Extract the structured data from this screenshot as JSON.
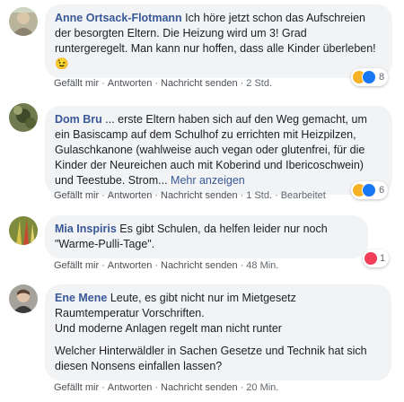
{
  "colors": {
    "link": "#385898",
    "bubble": "#f2f3f5",
    "meta": "#606770"
  },
  "actions": {
    "like": "Gefällt mir",
    "reply": "Antworten",
    "message": "Nachricht senden"
  },
  "comments": [
    {
      "author": "Anne Ortsack-Flotmann",
      "text": "Ich höre jetzt schon das Aufschreien der besorgten Eltern. Die Heizung wird um 3! Grad runtergeregelt. Man kann nur hoffen, dass alle Kinder überleben!",
      "emoji": "😉",
      "time": "2 Std.",
      "reactions": {
        "icons": [
          "haha-icon",
          "like-icon"
        ],
        "count": "8"
      }
    },
    {
      "author": "Dom Bru",
      "text": "... erste Eltern haben sich auf den Weg gemacht, um ein Basiscamp auf dem Schulhof zu errichten mit Heizpilzen, Gulaschkanone (wahlweise auch vegan oder glutenfrei, für die Kinder der Neureichen auch mit Koberind und Ibericoschwein) und Teestube. Strom...",
      "more": "Mehr anzeigen",
      "time": "1 Std.",
      "edited": "Bearbeitet",
      "reactions": {
        "icons": [
          "haha-icon",
          "like-icon"
        ],
        "count": "6"
      }
    },
    {
      "author": "Mia Inspiris",
      "text": "Es gibt Schulen, da helfen leider nur noch \"Warme-Pulli-Tage\".",
      "time": "48 Min.",
      "reactions": {
        "icons": [
          "love-icon"
        ],
        "count": "1"
      }
    },
    {
      "author": "Ene Mene",
      "text1": "Leute, es gibt nicht nur im Mietgesetz Raumtemperatur Vorschriften.",
      "text2": "Und moderne Anlagen regelt man nicht runter",
      "text3": "Welcher Hinterwäldler in Sachen Gesetze und Technik hat sich diesen Nonsens einfallen lassen?",
      "time": "20 Min."
    }
  ]
}
